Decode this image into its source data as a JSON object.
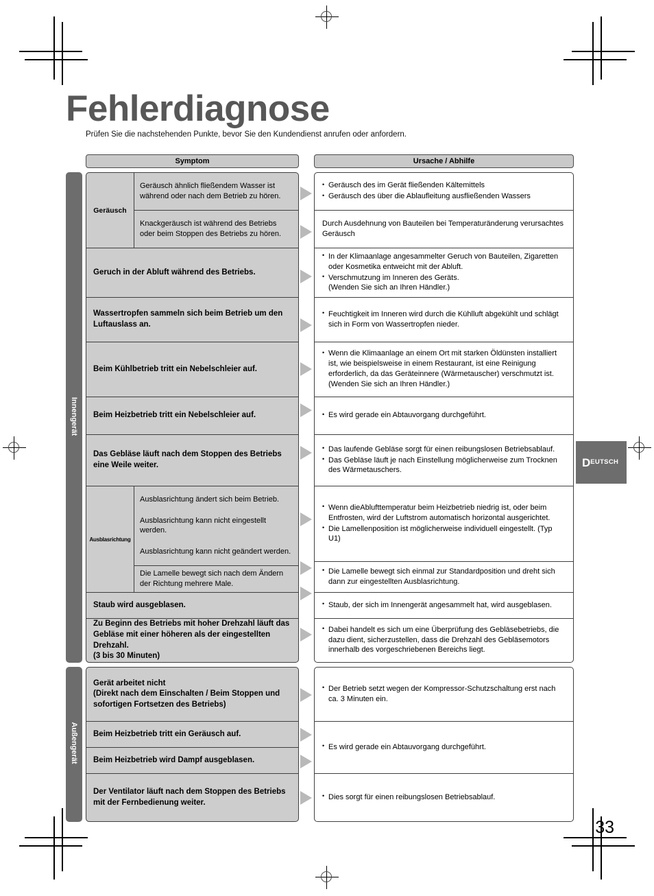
{
  "page": {
    "title": "Fehlerdiagnose",
    "intro": "Prüfen Sie die nachstehenden Punkte, bevor Sie den Kundendienst anrufen oder anfordern.",
    "number": "33",
    "language_tab": {
      "initial": "D",
      "rest": "EUTSCH"
    }
  },
  "table": {
    "headers": {
      "symptom": "Symptom",
      "cause": "Ursache / Abhilfe"
    },
    "units": {
      "indoor": "Innengerät",
      "outdoor": "Außengerät"
    },
    "categories": {
      "noise": "Geräusch",
      "air_direction": "Ausblasrichtung"
    },
    "indoor_symptoms": {
      "noise_sub1": "Geräusch ähnlich fließendem Wasser ist während oder nach dem Betrieb zu hören.",
      "noise_sub2": "Knackgeräusch ist während des Betriebs oder beim Stoppen des Betriebs zu hören.",
      "smell": "Geruch in der Abluft während des Betriebs.",
      "water_drops": "Wassertropfen sammeln sich beim Betrieb um den Luftauslass an.",
      "mist_cooling": "Beim Kühlbetrieb tritt ein Nebelschleier auf.",
      "mist_heating": "Beim Heizbetrieb tritt ein Nebelschleier auf.",
      "fan_continues": "Das Gebläse läuft nach dem Stoppen des Betriebs eine Weile weiter.",
      "dir_sub1": "Ausblasrichtung ändert sich beim Betrieb.",
      "dir_sub2": "Ausblasrichtung kann nicht eingestellt werden.",
      "dir_sub3": "Ausblasrichtung kann nicht geändert werden.",
      "dir_sub4": "Die Lamelle bewegt sich nach dem Ändern der Richtung mehrere Male.",
      "dust": "Staub wird ausgeblasen.",
      "high_speed": "Zu Beginn des Betriebs mit hoher Drehzahl läuft das Gebläse mit einer höheren als der eingestellten Drehzahl.\n(3 bis 30 Minuten)"
    },
    "indoor_causes": {
      "noise_1_a": "Geräusch des im Gerät fließenden Kältemittels",
      "noise_1_b": "Geräusch des über die Ablaufleitung ausfließenden Wassers",
      "noise_2": "Durch Ausdehnung von Bauteilen bei Temperaturänderung verursachtes Geräusch",
      "smell_a": "In der Klimaanlage angesammelter Geruch von Bauteilen, Zigaretten oder Kosmetika entweicht mit der Abluft.",
      "smell_b": "Verschmutzung im Inneren des Geräts.\n(Wenden Sie sich an Ihren Händler.)",
      "water_drops_a": "Feuchtigkeit im Inneren wird durch die Kühlluft abgekühlt und schlägt sich in Form von Wassertropfen nieder.",
      "mist_cooling_a": "Wenn die Klimaanlage an einem Ort mit starken Öldünsten installiert ist, wie beispielsweise in einem Restaurant, ist eine Reinigung erforderlich, da das Geräteinnere (Wärmetauscher) verschmutzt ist. (Wenden Sie sich an Ihren Händler.)",
      "mist_heating_a": "Es wird gerade ein Abtauvorgang durchgeführt.",
      "fan_a": "Das laufende Gebläse sorgt für einen reibungslosen Betriebsablauf.",
      "fan_b": "Das Gebläse läuft je nach Einstellung möglicherweise zum Trocknen des Wärmetauschers.",
      "dir_a": "Wenn dieAblufttemperatur beim Heizbetrieb niedrig ist, oder beim Entfrosten, wird der Luftstrom automatisch horizontal ausgerichtet.",
      "dir_b": "Die Lamellenposition ist möglicherweise individuell eingestellt. (Typ U1)",
      "dir_sub4_a": "Die Lamelle bewegt sich einmal zur Standardposition und dreht sich dann zur eingestellten Ausblasrichtung.",
      "dust_a": "Staub, der sich im Innengerät angesammelt hat, wird ausgeblasen.",
      "high_speed_a": "Dabei handelt es sich um eine Überprüfung des Gebläsebetriebs, die dazu dient, sicherzustellen, dass die Drehzahl des Gebläsemotors innerhalb des vorgeschriebenen Bereichs liegt."
    },
    "outdoor_symptoms": {
      "no_operation": "Gerät arbeitet nicht\n(Direkt nach dem Einschalten / Beim Stoppen und sofortigen Fortsetzen des Betriebs)",
      "heating_noise": "Beim Heizbetrieb tritt ein Geräusch auf.",
      "heating_steam": "Beim Heizbetrieb wird Dampf ausgeblasen.",
      "fan_remote": "Der Ventilator läuft nach dem Stoppen des Betriebs mit der Fernbedienung weiter."
    },
    "outdoor_causes": {
      "no_operation_a": "Der Betrieb setzt wegen der Kompressor-Schutzschaltung erst nach ca. 3 Minuten ein.",
      "defrost_a": "Es wird gerade ein Abtauvorgang durchgeführt.",
      "fan_remote_a": "Dies sorgt für einen reibungslosen Betriebsablauf."
    }
  }
}
